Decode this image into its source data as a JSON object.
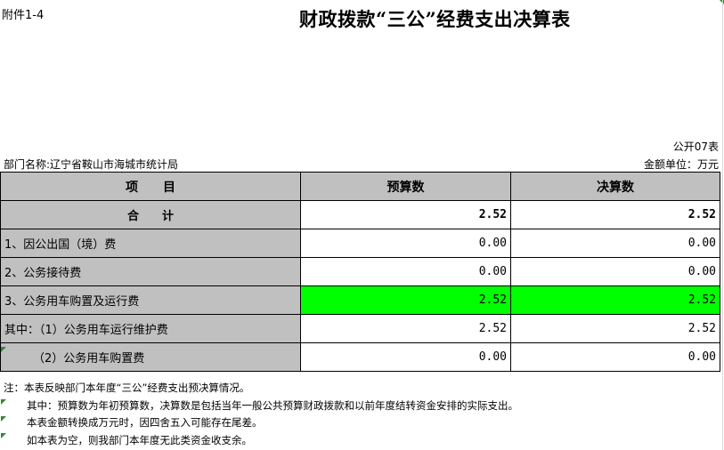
{
  "attachment": "附件1-4",
  "title": "财政拨款“三公”经费支出决算表",
  "form_no": "公开07表",
  "department": "部门名称:辽宁省鞍山市海城市统计局",
  "unit": "金额单位：万元",
  "table": {
    "headers": [
      "项　　目",
      "预算数",
      "决算数"
    ],
    "total": {
      "label": "合　　计",
      "budget": "2.52",
      "final": "2.52"
    },
    "rows": [
      {
        "label": "1、因公出国（境）费",
        "budget": "0.00",
        "final": "0.00"
      },
      {
        "label": "2、公务接待费",
        "budget": "0.00",
        "final": "0.00"
      },
      {
        "label": "3、公务用车购置及运行费",
        "budget": "2.52",
        "final": "2.52"
      },
      {
        "label": "其中：（1）公务用车运行维护费",
        "budget": "2.52",
        "final": "2.52"
      },
      {
        "label": "（2）公务用车购置费",
        "budget": "0.00",
        "final": "0.00"
      }
    ]
  },
  "notes": [
    "注：本表反映部门本年度“三公”经费支出预决算情况。",
    "其中：预算数为年初预算数，决算数是包括当年一般公共预算财政拨款和以前年度结转资金安排的实际支出。",
    "本表金额转换成万元时，因四舍五入可能存在尾差。",
    "如本表为空，则我部门本年度无此类资金收支余。"
  ],
  "colors": {
    "header_gray": "#c0c0c0",
    "highlight_green": "#00ff00",
    "marker_green": "#2e8b2e"
  }
}
